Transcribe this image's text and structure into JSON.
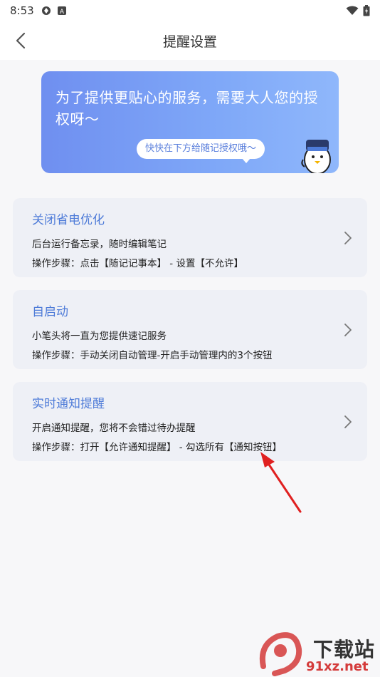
{
  "status": {
    "time": "8:53"
  },
  "header": {
    "title": "提醒设置"
  },
  "banner": {
    "text": "为了提供更贴心的服务，需要大人您的授权呀～",
    "bubble": "快快在下方给随记授权哦～"
  },
  "cards": [
    {
      "title": "关闭省电优化",
      "line1": "后台运行备忘录，随时编辑笔记",
      "line2": "操作步骤：点击【随记记事本】 - 设置【不允许】"
    },
    {
      "title": "自启动",
      "line1": "小笔头将一直为您提供速记服务",
      "line2": "操作步骤：手动关闭自动管理-开启手动管理内的3个按钮"
    },
    {
      "title": "实时通知提醒",
      "line1": "开启通知提醒，您将不会错过待办提醒",
      "line2": "操作步骤：打开【允许通知提醒】 - 勾选所有【通知按钮】"
    }
  ],
  "watermark": {
    "line1": "下载站",
    "line2": "91xz.net"
  },
  "colors": {
    "accent": "#4e7bd8",
    "card": "#eef0f6",
    "annotation": "#e02020"
  }
}
